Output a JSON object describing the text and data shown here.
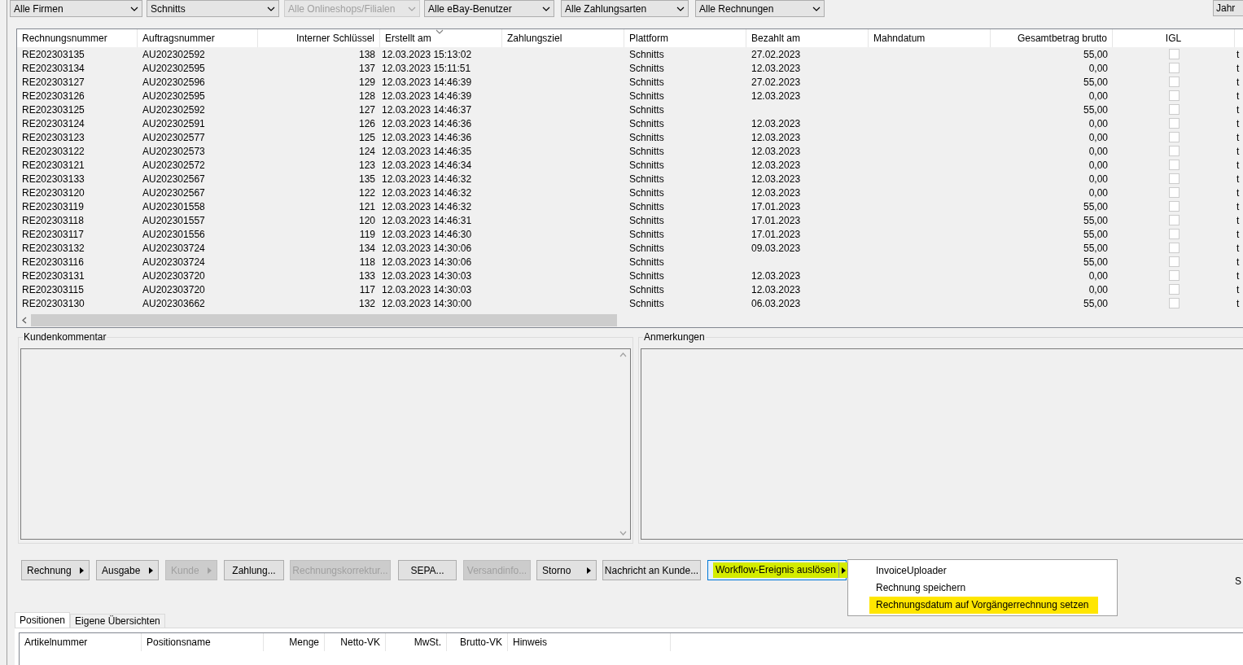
{
  "filters": [
    {
      "value": "Alle Firmen",
      "disabled": false
    },
    {
      "value": "Schnitts",
      "disabled": false
    },
    {
      "value": "Alle Onlineshops/Filialen",
      "disabled": true
    },
    {
      "value": "Alle eBay-Benutzer",
      "disabled": false
    },
    {
      "value": "Alle Zahlungsarten",
      "disabled": false
    },
    {
      "value": "Alle Rechnungen",
      "disabled": false
    }
  ],
  "year_button": "Jahr",
  "invoice_table": {
    "columns": [
      {
        "label": "Rechnungsnummer",
        "sorted": false
      },
      {
        "label": "Auftragsnummer",
        "sorted": false
      },
      {
        "label": "Interner Schlüssel",
        "sorted": false
      },
      {
        "label": "Erstellt am",
        "sorted": true
      },
      {
        "label": "Zahlungsziel",
        "sorted": false
      },
      {
        "label": "Plattform",
        "sorted": false
      },
      {
        "label": "Bezahlt am",
        "sorted": false
      },
      {
        "label": "Mahndatum",
        "sorted": false
      },
      {
        "label": "Gesamtbetrag brutto",
        "sorted": false
      },
      {
        "label": "IGL",
        "sorted": false
      }
    ],
    "rows": [
      {
        "rechnungsnummer": "RE202303135",
        "auftragsnummer": "AU202302592",
        "schluessel": "138",
        "erstellt": "12.03.2023 15:13:02",
        "plattform": "Schnitts",
        "bezahlt": "27.02.2023",
        "brutto": "55,00",
        "igl": false,
        "column_11": "t"
      },
      {
        "rechnungsnummer": "RE202303134",
        "auftragsnummer": "AU202302595",
        "schluessel": "137",
        "erstellt": "12.03.2023 15:11:51",
        "plattform": "Schnitts",
        "bezahlt": "12.03.2023",
        "brutto": "0,00",
        "igl": false,
        "column_11": "t"
      },
      {
        "rechnungsnummer": "RE202303127",
        "auftragsnummer": "AU202302596",
        "schluessel": "129",
        "erstellt": "12.03.2023 14:46:39",
        "plattform": "Schnitts",
        "bezahlt": "27.02.2023",
        "brutto": "55,00",
        "igl": false,
        "column_11": "t"
      },
      {
        "rechnungsnummer": "RE202303126",
        "auftragsnummer": "AU202302595",
        "schluessel": "128",
        "erstellt": "12.03.2023 14:46:39",
        "plattform": "Schnitts",
        "bezahlt": "12.03.2023",
        "brutto": "0,00",
        "igl": false,
        "column_11": "t"
      },
      {
        "rechnungsnummer": "RE202303125",
        "auftragsnummer": "AU202302592",
        "schluessel": "127",
        "erstellt": "12.03.2023 14:46:37",
        "plattform": "Schnitts",
        "brutto": "55,00",
        "igl": false,
        "column_11": "t"
      },
      {
        "rechnungsnummer": "RE202303124",
        "auftragsnummer": "AU202302591",
        "schluessel": "126",
        "erstellt": "12.03.2023 14:46:36",
        "plattform": "Schnitts",
        "bezahlt": "12.03.2023",
        "brutto": "0,00",
        "igl": false,
        "column_11": "t"
      },
      {
        "rechnungsnummer": "RE202303123",
        "auftragsnummer": "AU202302577",
        "schluessel": "125",
        "erstellt": "12.03.2023 14:46:36",
        "plattform": "Schnitts",
        "bezahlt": "12.03.2023",
        "brutto": "0,00",
        "igl": false,
        "column_11": "t"
      },
      {
        "rechnungsnummer": "RE202303122",
        "auftragsnummer": "AU202302573",
        "schluessel": "124",
        "erstellt": "12.03.2023 14:46:35",
        "plattform": "Schnitts",
        "bezahlt": "12.03.2023",
        "brutto": "0,00",
        "igl": false,
        "column_11": "t"
      },
      {
        "rechnungsnummer": "RE202303121",
        "auftragsnummer": "AU202302572",
        "schluessel": "123",
        "erstellt": "12.03.2023 14:46:34",
        "plattform": "Schnitts",
        "bezahlt": "12.03.2023",
        "brutto": "0,00",
        "igl": false,
        "column_11": "t"
      },
      {
        "rechnungsnummer": "RE202303133",
        "auftragsnummer": "AU202302567",
        "schluessel": "135",
        "erstellt": "12.03.2023 14:46:32",
        "plattform": "Schnitts",
        "bezahlt": "12.03.2023",
        "brutto": "0,00",
        "igl": false,
        "column_11": "t"
      },
      {
        "rechnungsnummer": "RE202303120",
        "auftragsnummer": "AU202302567",
        "schluessel": "122",
        "erstellt": "12.03.2023 14:46:32",
        "plattform": "Schnitts",
        "bezahlt": "12.03.2023",
        "brutto": "0,00",
        "igl": false,
        "column_11": "t"
      },
      {
        "rechnungsnummer": "RE202303119",
        "auftragsnummer": "AU202301558",
        "schluessel": "121",
        "erstellt": "12.03.2023 14:46:32",
        "plattform": "Schnitts",
        "bezahlt": "17.01.2023",
        "brutto": "55,00",
        "igl": false,
        "column_11": "t"
      },
      {
        "rechnungsnummer": "RE202303118",
        "auftragsnummer": "AU202301557",
        "schluessel": "120",
        "erstellt": "12.03.2023 14:46:31",
        "plattform": "Schnitts",
        "bezahlt": "17.01.2023",
        "brutto": "55,00",
        "igl": false,
        "column_11": "t"
      },
      {
        "rechnungsnummer": "RE202303117",
        "auftragsnummer": "AU202301556",
        "schluessel": "119",
        "erstellt": "12.03.2023 14:46:30",
        "plattform": "Schnitts",
        "bezahlt": "17.01.2023",
        "brutto": "55,00",
        "igl": false,
        "column_11": "t"
      },
      {
        "rechnungsnummer": "RE202303132",
        "auftragsnummer": "AU202303724",
        "schluessel": "134",
        "erstellt": "12.03.2023 14:30:06",
        "plattform": "Schnitts",
        "bezahlt": "09.03.2023",
        "brutto": "55,00",
        "igl": false,
        "column_11": "t"
      },
      {
        "rechnungsnummer": "RE202303116",
        "auftragsnummer": "AU202303724",
        "schluessel": "118",
        "erstellt": "12.03.2023 14:30:06",
        "plattform": "Schnitts",
        "brutto": "55,00",
        "igl": false,
        "column_11": "t"
      },
      {
        "rechnungsnummer": "RE202303131",
        "auftragsnummer": "AU202303720",
        "schluessel": "133",
        "erstellt": "12.03.2023 14:30:03",
        "plattform": "Schnitts",
        "bezahlt": "12.03.2023",
        "brutto": "0,00",
        "igl": false,
        "column_11": "t"
      },
      {
        "rechnungsnummer": "RE202303115",
        "auftragsnummer": "AU202303720",
        "schluessel": "117",
        "erstellt": "12.03.2023 14:30:03",
        "plattform": "Schnitts",
        "bezahlt": "12.03.2023",
        "brutto": "0,00",
        "igl": false,
        "column_11": "t"
      },
      {
        "rechnungsnummer": "RE202303130",
        "auftragsnummer": "AU202303662",
        "schluessel": "132",
        "erstellt": "12.03.2023 14:30:00",
        "plattform": "Schnitts",
        "bezahlt": "06.03.2023",
        "brutto": "55,00",
        "igl": false,
        "column_11": "t"
      }
    ]
  },
  "kundenkommentar": {
    "title": "Kundenkommentar"
  },
  "anmerkungen": {
    "title": "Anmerkungen"
  },
  "buttons": [
    {
      "label": "Rechnung",
      "disabled": false,
      "submenu": true,
      "highlighted": false
    },
    {
      "label": "Ausgabe",
      "disabled": false,
      "submenu": true,
      "highlighted": false
    },
    {
      "label": "Kunde",
      "disabled": true,
      "submenu": true,
      "highlighted": false
    },
    {
      "label": "Zahlung...",
      "disabled": false,
      "submenu": false,
      "highlighted": false
    },
    {
      "label": "Rechnungskorrektur...",
      "disabled": true,
      "submenu": false,
      "highlighted": false
    },
    {
      "label": "SEPA...",
      "disabled": false,
      "submenu": false,
      "highlighted": false
    },
    {
      "label": "Versandinfo...",
      "disabled": true,
      "submenu": false,
      "highlighted": false
    },
    {
      "label": "Storno",
      "disabled": false,
      "submenu": true,
      "highlighted": false
    },
    {
      "label": "Nachricht an Kunde...",
      "disabled": false,
      "submenu": false,
      "highlighted": false
    },
    {
      "label": "Workflow-Ereignis auslösen",
      "disabled": false,
      "submenu": true,
      "highlighted": true
    }
  ],
  "workflow_menu": [
    {
      "label": "InvoiceUploader",
      "selected": false
    },
    {
      "label": "Rechnung speichern",
      "selected": false
    },
    {
      "label": "Rechnungsdatum auf Vorgängerrechnung setzen",
      "selected": true
    }
  ],
  "edge_label": "S",
  "tabs": [
    {
      "label": "Positionen",
      "selected": true
    },
    {
      "label": "Eigene Übersichten",
      "selected": false
    }
  ],
  "positions_table": {
    "columns": [
      "Artikelnummer",
      "Positionsname",
      "Menge",
      "Netto-VK",
      "MwSt.",
      "Brutto-VK",
      "Hinweis"
    ]
  }
}
